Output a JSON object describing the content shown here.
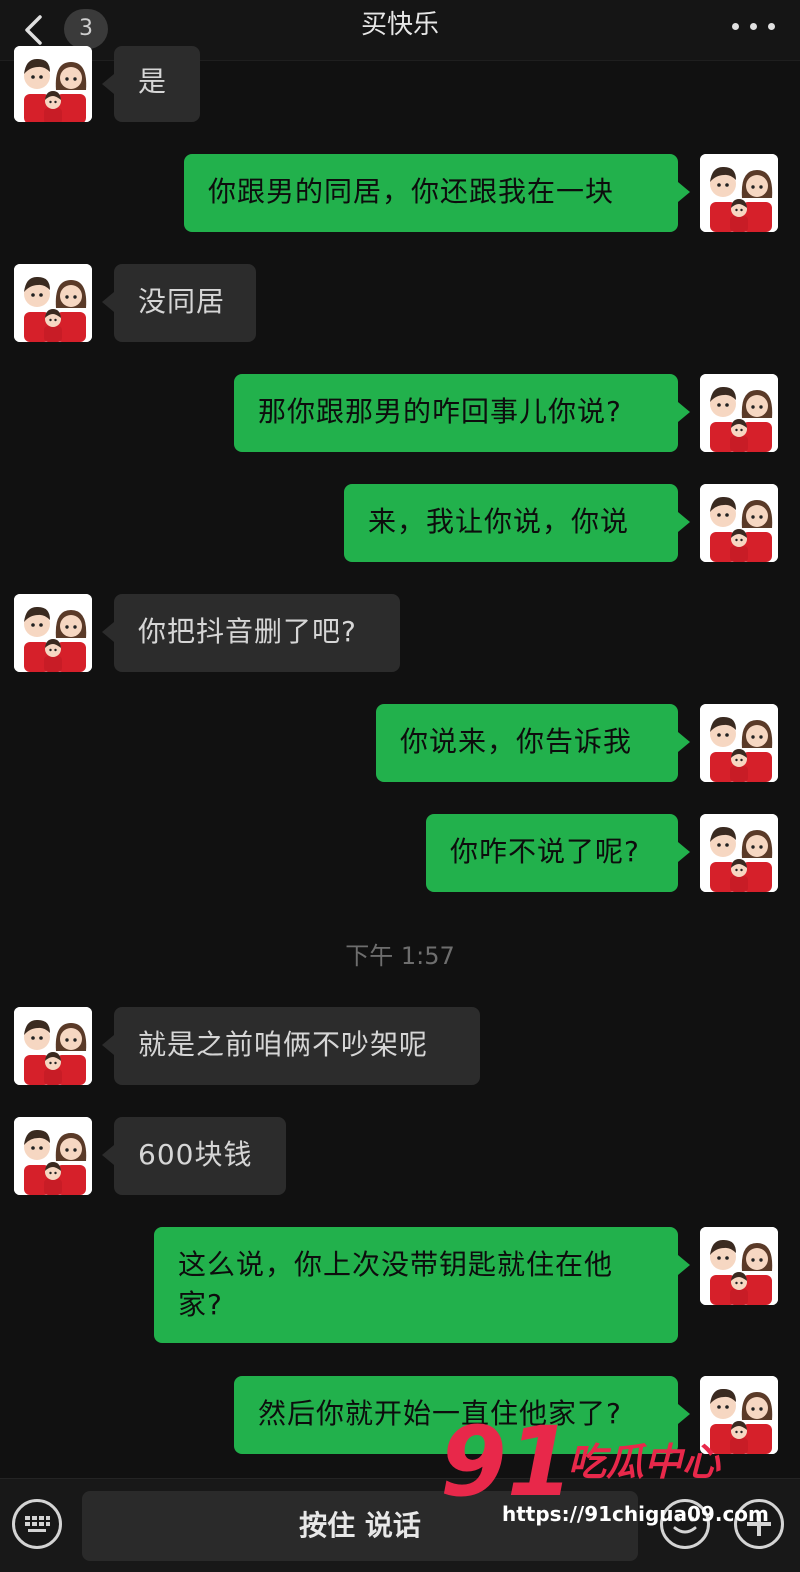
{
  "header": {
    "title": "买快乐",
    "unread_count": "3",
    "back_icon": "chevron-left-icon",
    "more_icon": "ellipsis-icon"
  },
  "messages": [
    {
      "side": "in",
      "text": "是"
    },
    {
      "side": "out",
      "text": "你跟男的同居，你还跟我在一块"
    },
    {
      "side": "in",
      "text": "没同居"
    },
    {
      "side": "out",
      "text": "那你跟那男的咋回事儿你说?"
    },
    {
      "side": "out",
      "text": "来，我让你说，你说"
    },
    {
      "side": "in",
      "text": "你把抖音删了吧?"
    },
    {
      "side": "out",
      "text": "你说来，你告诉我"
    },
    {
      "side": "out",
      "text": "你咋不说了呢?"
    },
    {
      "side": "in",
      "text": "就是之前咱俩不吵架呢"
    },
    {
      "side": "in",
      "text": "600块钱"
    },
    {
      "side": "out",
      "text": "这么说，你上次没带钥匙就住在他家?"
    },
    {
      "side": "out",
      "text": "然后你就开始一直住他家了?"
    }
  ],
  "timestamp": "下午 1:57",
  "input_bar": {
    "hold_to_talk_label": "按住 说话",
    "keyboard_icon": "keyboard-icon",
    "emoji_icon": "emoji-icon",
    "plus_icon": "plus-icon"
  },
  "watermark": {
    "number": "91",
    "name": "吃瓜中心",
    "url": "https://91chigua09.com"
  },
  "colors": {
    "background": "#111111",
    "bubble_in": "#2c2c2c",
    "bubble_out": "#22b14c",
    "watermark": "#e8284a"
  }
}
